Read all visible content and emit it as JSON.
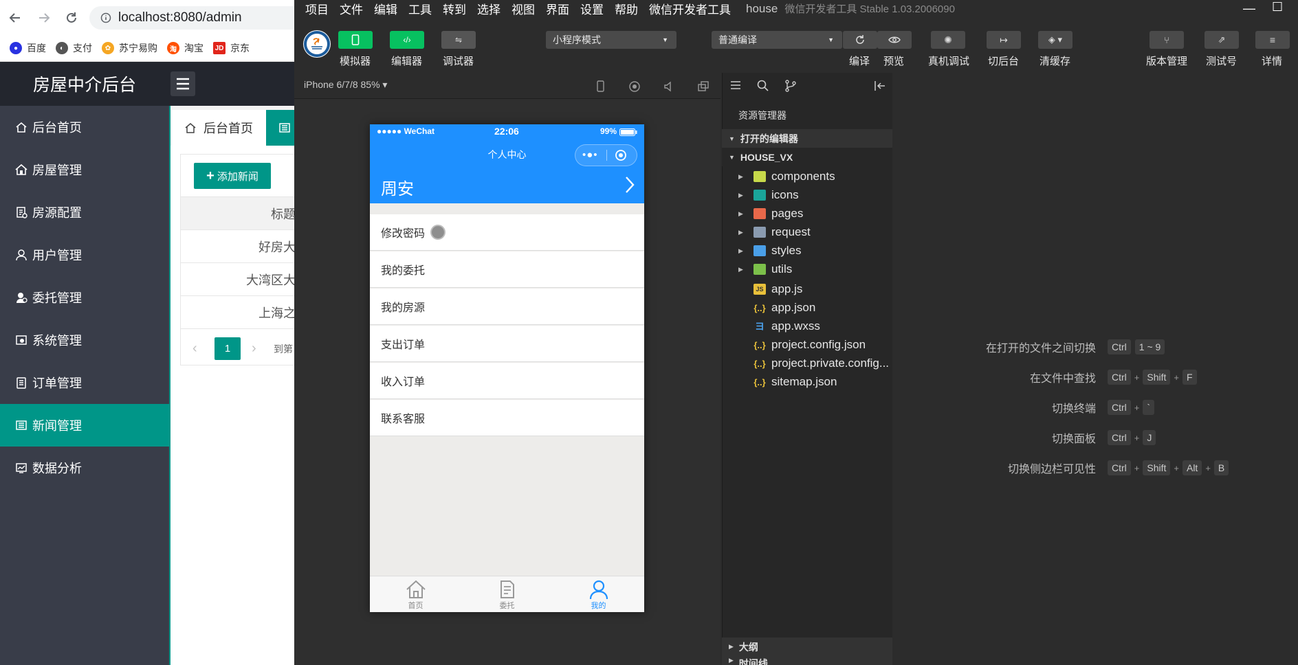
{
  "browser": {
    "url": "localhost:8080/admin",
    "bookmarks": [
      {
        "label": "百度",
        "color": "#2932e1"
      },
      {
        "label": "支付",
        "color": "#555555"
      },
      {
        "label": "苏宁易购",
        "color": "#f5a623"
      },
      {
        "label": "淘宝",
        "color": "#ff5000"
      },
      {
        "label": "京东",
        "color": "#e1251b"
      }
    ]
  },
  "admin": {
    "title": "房屋中介后台",
    "menu": [
      {
        "label": "后台首页",
        "icon": "home-icon"
      },
      {
        "label": "房屋管理",
        "icon": "house-icon"
      },
      {
        "label": "房源配置",
        "icon": "config-icon"
      },
      {
        "label": "用户管理",
        "icon": "user-icon"
      },
      {
        "label": "委托管理",
        "icon": "entrust-icon"
      },
      {
        "label": "系统管理",
        "icon": "system-icon"
      },
      {
        "label": "订单管理",
        "icon": "order-icon"
      },
      {
        "label": "新闻管理",
        "icon": "news-icon"
      },
      {
        "label": "数据分析",
        "icon": "chart-icon"
      }
    ],
    "active_menu": "新闻管理",
    "tabs": [
      {
        "label": "后台首页"
      }
    ],
    "add_button": "添加新闻",
    "table": {
      "header": "标题",
      "rows": [
        "好房大",
        "大湾区大",
        "上海之"
      ]
    },
    "pager": {
      "current": "1",
      "goto": "到第"
    },
    "accent": "#009688"
  },
  "devtools": {
    "menu": [
      "项目",
      "文件",
      "编辑",
      "工具",
      "转到",
      "选择",
      "视图",
      "界面",
      "设置",
      "帮助",
      "微信开发者工具"
    ],
    "project": "house",
    "app_title": "微信开发者工具 Stable 1.03.2006090",
    "toolbar": {
      "simulator": "模拟器",
      "editor": "编辑器",
      "debugger": "调试器",
      "mode": "小程序模式",
      "compile_mode": "普通编译",
      "compile": "编译",
      "preview": "预览",
      "remote_debug": "真机调试",
      "background": "切后台",
      "clear_cache": "清缓存",
      "version": "版本管理",
      "test_account": "测试号",
      "details": "详情"
    },
    "device": "iPhone 6/7/8 85%",
    "phone": {
      "carrier": "●●●●● WeChat",
      "time": "22:06",
      "battery": "99%",
      "nav_title": "个人中心",
      "username": "周安",
      "items": [
        "修改密码",
        "我的委托",
        "我的房源",
        "支出订单",
        "收入订单",
        "联系客服"
      ],
      "tabs": [
        {
          "label": "首页",
          "icon": "home-icon"
        },
        {
          "label": "委托",
          "icon": "document-icon"
        },
        {
          "label": "我的",
          "icon": "profile-icon"
        }
      ],
      "active_tab": "我的",
      "brand": "#1e90ff"
    },
    "explorer": {
      "title": "资源管理器",
      "open_editors": "打开的编辑器",
      "project_root": "HOUSE_VX",
      "folders": [
        {
          "name": "components",
          "color": "#c7d94a"
        },
        {
          "name": "icons",
          "color": "#1aa59a"
        },
        {
          "name": "pages",
          "color": "#e8684a"
        },
        {
          "name": "request",
          "color": "#8a9bb0"
        },
        {
          "name": "styles",
          "color": "#4a9fe8"
        },
        {
          "name": "utils",
          "color": "#7cc04a"
        }
      ],
      "files": [
        {
          "name": "app.js",
          "type": "js"
        },
        {
          "name": "app.json",
          "type": "json"
        },
        {
          "name": "app.wxss",
          "type": "css"
        },
        {
          "name": "project.config.json",
          "type": "json"
        },
        {
          "name": "project.private.config...",
          "type": "json"
        },
        {
          "name": "sitemap.json",
          "type": "json"
        }
      ],
      "outline": "大纲",
      "timeline": "时间线"
    },
    "shortcuts": [
      {
        "label": "在打开的文件之间切换",
        "keys": [
          "Ctrl",
          "1 ~ 9"
        ]
      },
      {
        "label": "在文件中查找",
        "keys": [
          "Ctrl",
          "+",
          "Shift",
          "+",
          "F"
        ]
      },
      {
        "label": "切换终端",
        "keys": [
          "Ctrl",
          "+",
          "`"
        ]
      },
      {
        "label": "切换面板",
        "keys": [
          "Ctrl",
          "+",
          "J"
        ]
      },
      {
        "label": "切换侧边栏可见性",
        "keys": [
          "Ctrl",
          "+",
          "Shift",
          "+",
          "Alt",
          "+",
          "B"
        ]
      }
    ]
  }
}
